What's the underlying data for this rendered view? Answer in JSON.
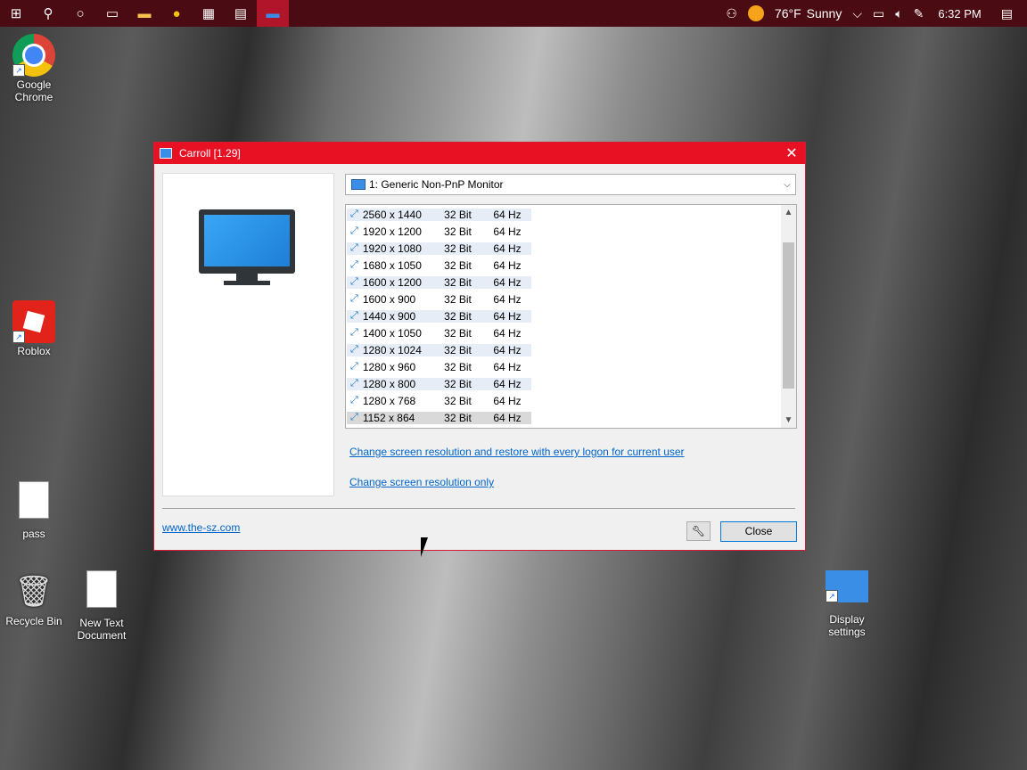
{
  "taskbar": {
    "weather": {
      "temp": "76°F",
      "condition": "Sunny"
    },
    "clock": "6:32 PM",
    "buttons": [
      "start-icon",
      "search-icon",
      "cortana-icon",
      "task-view-icon",
      "file-explorer-icon",
      "chrome-icon",
      "store-icon",
      "terminal-icon",
      "carroll-icon"
    ]
  },
  "desktop": {
    "icons": [
      {
        "label": "Google Chrome"
      },
      {
        "label": "Roblox"
      },
      {
        "label": "pass"
      },
      {
        "label": "Recycle Bin"
      },
      {
        "label": "New Text Document"
      },
      {
        "label": "Display settings"
      }
    ]
  },
  "dialog": {
    "title": "Carroll [1.29]",
    "monitor_select": "1: Generic Non-PnP Monitor",
    "resolutions": [
      {
        "res": "2560 x 1440",
        "depth": "32 Bit",
        "hz": "64 Hz"
      },
      {
        "res": "1920 x 1200",
        "depth": "32 Bit",
        "hz": "64 Hz"
      },
      {
        "res": "1920 x 1080",
        "depth": "32 Bit",
        "hz": "64 Hz"
      },
      {
        "res": "1680 x 1050",
        "depth": "32 Bit",
        "hz": "64 Hz"
      },
      {
        "res": "1600 x 1200",
        "depth": "32 Bit",
        "hz": "64 Hz"
      },
      {
        "res": "1600 x 900",
        "depth": "32 Bit",
        "hz": "64 Hz"
      },
      {
        "res": "1440 x 900",
        "depth": "32 Bit",
        "hz": "64 Hz"
      },
      {
        "res": "1400 x 1050",
        "depth": "32 Bit",
        "hz": "64 Hz"
      },
      {
        "res": "1280 x 1024",
        "depth": "32 Bit",
        "hz": "64 Hz"
      },
      {
        "res": "1280 x 960",
        "depth": "32 Bit",
        "hz": "64 Hz"
      },
      {
        "res": "1280 x 800",
        "depth": "32 Bit",
        "hz": "64 Hz"
      },
      {
        "res": "1280 x 768",
        "depth": "32 Bit",
        "hz": "64 Hz"
      },
      {
        "res": "1152 x 864",
        "depth": "32 Bit",
        "hz": "64 Hz"
      }
    ],
    "selected_resolution": "1152 x 864",
    "link_restore": "Change screen resolution and restore with every logon for current user",
    "link_only": "Change screen resolution only",
    "website": "www.the-sz.com",
    "close_label": "Close"
  }
}
